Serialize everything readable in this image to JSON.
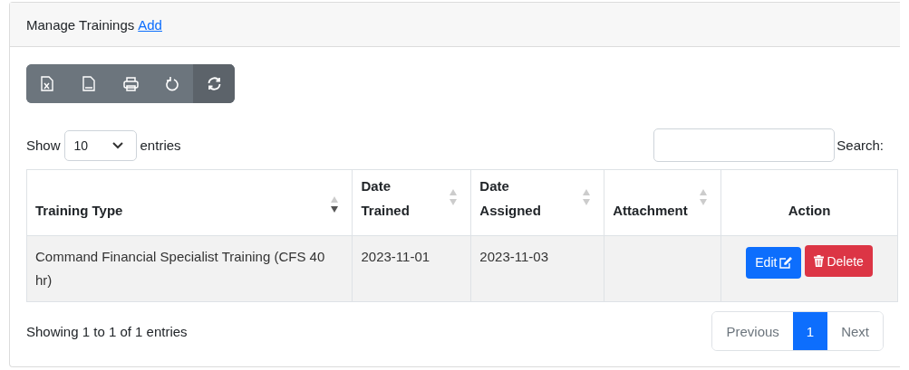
{
  "card": {
    "title": "Manage Trainings",
    "link": "Add"
  },
  "toolbar": [
    {
      "kind": "excel",
      "active": false
    },
    {
      "kind": "csv",
      "active": false
    },
    {
      "kind": "print",
      "active": false
    },
    {
      "kind": "reset",
      "active": false
    },
    {
      "kind": "reload",
      "active": true
    }
  ],
  "length": {
    "before": "Show",
    "value": "10",
    "after": "entries"
  },
  "search": {
    "label": "Search:"
  },
  "table": {
    "columns": [
      {
        "label": "Training Type",
        "sortable": true,
        "sorted": true
      },
      {
        "label": "Date Trained",
        "sortable": true,
        "sorted": false
      },
      {
        "label": "Date Assigned",
        "sortable": true,
        "sorted": false
      },
      {
        "label": "Attachment",
        "sortable": true,
        "sorted": false
      },
      {
        "label": "Action",
        "sortable": false,
        "sorted": false
      }
    ],
    "rows": [
      {
        "cells": [
          "Command Financial Specialist Training (CFS 40 hr)",
          "2023-11-01",
          "2023-11-03"
        ],
        "actions": [
          {
            "kind": "edit",
            "label": "Edit"
          },
          {
            "kind": "delete",
            "label": "Delete"
          }
        ]
      }
    ]
  },
  "info": "Showing 1 to 1 of 1 entries",
  "pagination": [
    {
      "label": "Previous",
      "selected": false,
      "disabled": true
    },
    {
      "label": "1",
      "selected": true,
      "disabled": false
    },
    {
      "label": "Next",
      "selected": false,
      "disabled": true
    }
  ]
}
